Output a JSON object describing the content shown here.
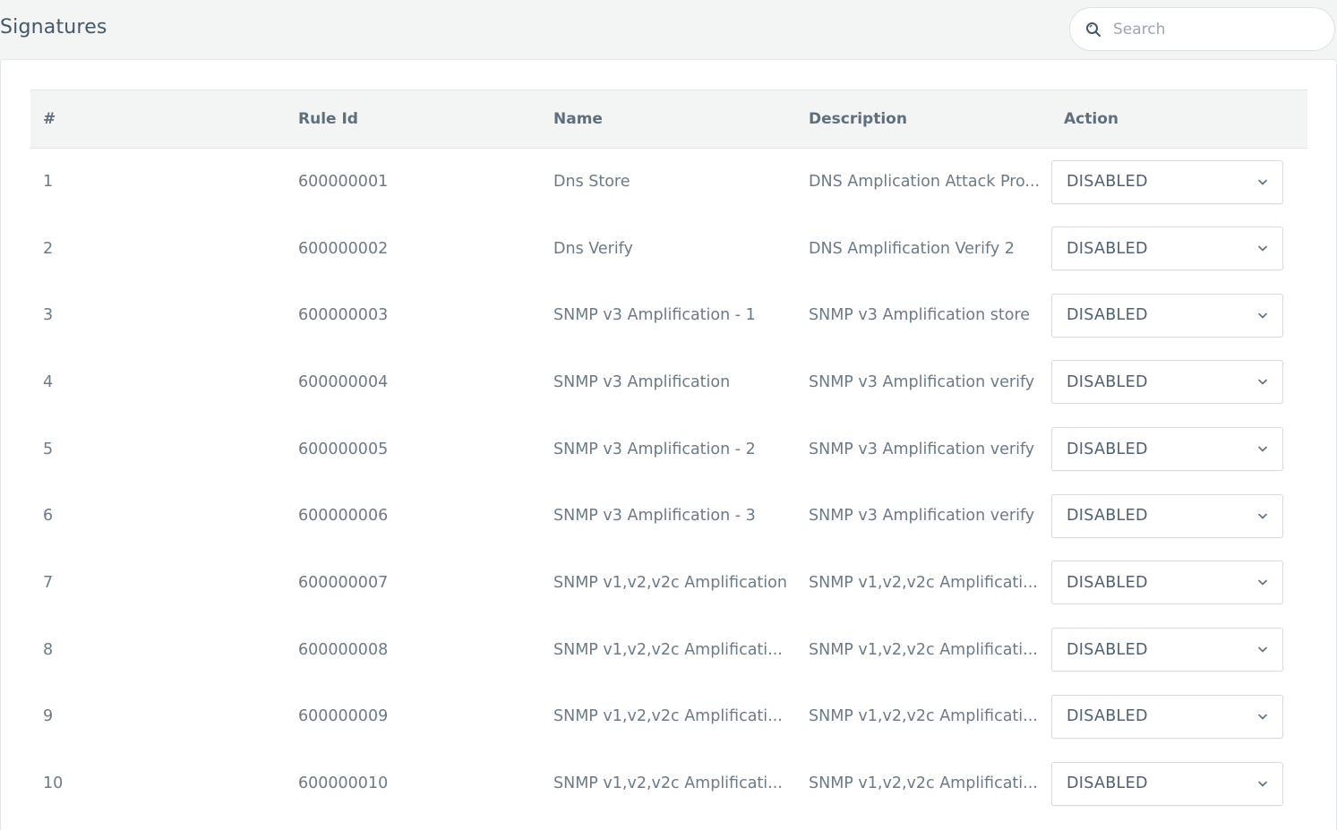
{
  "header": {
    "title": "Signatures"
  },
  "search": {
    "placeholder": "Search"
  },
  "table": {
    "columns": [
      "#",
      "Rule Id",
      "Name",
      "Description",
      "Action"
    ],
    "rows": [
      {
        "num": "1",
        "rule_id": "600000001",
        "name": "Dns Store",
        "description": "DNS Amplication Attack Pro...",
        "action": "DISABLED"
      },
      {
        "num": "2",
        "rule_id": "600000002",
        "name": "Dns Verify",
        "description": "DNS Amplification Verify 2",
        "action": "DISABLED"
      },
      {
        "num": "3",
        "rule_id": "600000003",
        "name": "SNMP v3 Amplification - 1",
        "description": "SNMP v3 Amplification store",
        "action": "DISABLED"
      },
      {
        "num": "4",
        "rule_id": "600000004",
        "name": "SNMP v3 Amplification",
        "description": "SNMP v3 Amplification verify",
        "action": "DISABLED"
      },
      {
        "num": "5",
        "rule_id": "600000005",
        "name": "SNMP v3 Amplification - 2",
        "description": "SNMP v3 Amplification verify",
        "action": "DISABLED"
      },
      {
        "num": "6",
        "rule_id": "600000006",
        "name": "SNMP v3 Amplification - 3",
        "description": "SNMP v3 Amplification verify",
        "action": "DISABLED"
      },
      {
        "num": "7",
        "rule_id": "600000007",
        "name": "SNMP v1,v2,v2c Amplification",
        "description": "SNMP v1,v2,v2c Amplificati...",
        "action": "DISABLED"
      },
      {
        "num": "8",
        "rule_id": "600000008",
        "name": "SNMP v1,v2,v2c Amplificati...",
        "description": "SNMP v1,v2,v2c Amplificati...",
        "action": "DISABLED"
      },
      {
        "num": "9",
        "rule_id": "600000009",
        "name": "SNMP v1,v2,v2c Amplificati...",
        "description": "SNMP v1,v2,v2c Amplificati...",
        "action": "DISABLED"
      },
      {
        "num": "10",
        "rule_id": "600000010",
        "name": "SNMP v1,v2,v2c Amplificati...",
        "description": "SNMP v1,v2,v2c Amplificati...",
        "action": "DISABLED"
      }
    ]
  },
  "icons": {
    "search": "search-icon",
    "dropdown": "chevron-down-icon"
  }
}
